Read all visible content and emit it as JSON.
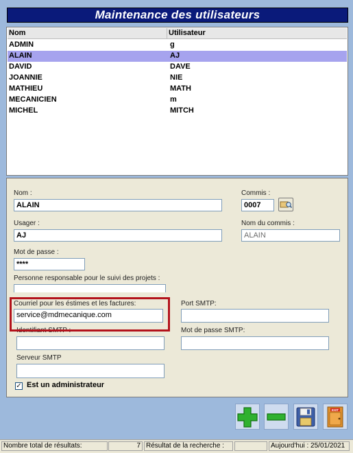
{
  "window": {
    "title": "Maintenance des utilisateurs"
  },
  "list": {
    "columns": [
      "Nom",
      "Utilisateur"
    ],
    "rows": [
      {
        "nom": "ADMIN",
        "utilisateur": "g"
      },
      {
        "nom": "ALAIN",
        "utilisateur": "AJ"
      },
      {
        "nom": "DAVID",
        "utilisateur": "DAVE"
      },
      {
        "nom": "JOANNIE",
        "utilisateur": "NIE"
      },
      {
        "nom": "MATHIEU",
        "utilisateur": "MATH"
      },
      {
        "nom": "MECANICIEN",
        "utilisateur": "m"
      },
      {
        "nom": "MICHEL",
        "utilisateur": "MITCH"
      }
    ],
    "selected_index": 1,
    "selection_color": "#a6a3ee"
  },
  "form": {
    "nom_label": "Nom :",
    "nom_value": "ALAIN",
    "commis_label": "Commis :",
    "commis_value": "0007",
    "usager_label": "Usager :",
    "usager_value": "AJ",
    "nom_commis_label": "Nom du commis :",
    "nom_commis_value": "ALAIN",
    "mdp_label": "Mot de passe :",
    "mdp_value": "****",
    "responsable_label": "Personne responsable pour le suivi des projets :",
    "responsable_value": "",
    "courriel_label": "Courriel pour les éstimes et les factures:",
    "courriel_value": "service@mdmecanique.com",
    "port_label": "Port SMTP:",
    "port_value": "",
    "identifiant_label": "Identifiant SMTP :",
    "identifiant_value": "",
    "mdp_smtp_label": "Mot de passe SMTP:",
    "mdp_smtp_value": "",
    "serveur_label": "Serveur SMTP",
    "serveur_value": "",
    "admin_label": "Est un administrateur",
    "admin_checked": true,
    "highlight_color": "#b3121b"
  },
  "toolbar": {
    "add_icon": "plus-icon",
    "remove_icon": "minus-icon",
    "save_icon": "floppy-disk-icon",
    "exit_icon": "exit-door-icon",
    "exit_text": "EXIT"
  },
  "status": {
    "total_label": "Nombre total de résultats:",
    "total_value": "7",
    "search_label": "Résultat de la recherche :",
    "search_value": "",
    "date_text": "Aujourd'hui : 25/01/2021"
  },
  "colors": {
    "title_bg": "#0a1a7a",
    "window_bg": "#9db9dc",
    "panel_bg": "#ece9d8"
  }
}
